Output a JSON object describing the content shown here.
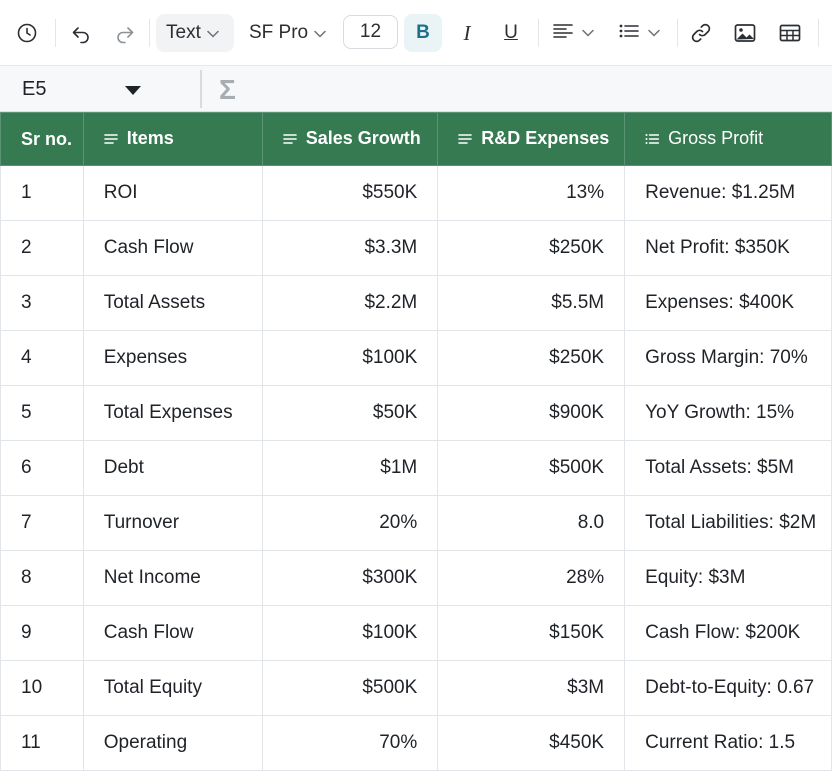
{
  "toolbar": {
    "icons": [
      "history-icon",
      "undo-icon",
      "redo-icon",
      "align-left-icon",
      "bullet-list-icon",
      "link-icon",
      "image-icon",
      "table-icon"
    ],
    "format_select": "Text",
    "font_family": "SF Pro",
    "font_size": "12",
    "bold_label": "B",
    "italic_label": "I",
    "underline_label": "U",
    "accent_color": "#1d6f8a"
  },
  "formula_bar": {
    "cell_ref": "E5",
    "sigma": "Σ"
  },
  "grid": {
    "header_color": "#357a51",
    "columns": [
      "Sr no.",
      "Items",
      "Sales Growth",
      "R&D Expenses",
      "Gross Profit"
    ],
    "rows": [
      [
        "1",
        "ROI",
        "$550K",
        "13%",
        "Revenue: $1.25M"
      ],
      [
        "2",
        "Cash Flow",
        "$3.3M",
        "$250K",
        "Net Profit: $350K"
      ],
      [
        "3",
        "Total Assets",
        "$2.2M",
        "$5.5M",
        "Expenses: $400K"
      ],
      [
        "4",
        "Expenses",
        "$100K",
        "$250K",
        "Gross Margin: 70%"
      ],
      [
        "5",
        "Total Expenses",
        "$50K",
        "$900K",
        "YoY Growth: 15%"
      ],
      [
        "6",
        "Debt",
        "$1M",
        "$500K",
        "Total Assets: $5M"
      ],
      [
        "7",
        "Turnover",
        "20%",
        "8.0",
        "Total Liabilities: $2M"
      ],
      [
        "8",
        "Net Income",
        "$300K",
        "28%",
        "Equity: $3M"
      ],
      [
        "9",
        "Cash Flow",
        "$100K",
        "$150K",
        "Cash Flow: $200K"
      ],
      [
        "10",
        "Total Equity",
        "$500K",
        "$3M",
        "Debt-to-Equity: 0.67"
      ],
      [
        "11",
        "Operating",
        "70%",
        "$450K",
        "Current Ratio: 1.5"
      ]
    ]
  }
}
